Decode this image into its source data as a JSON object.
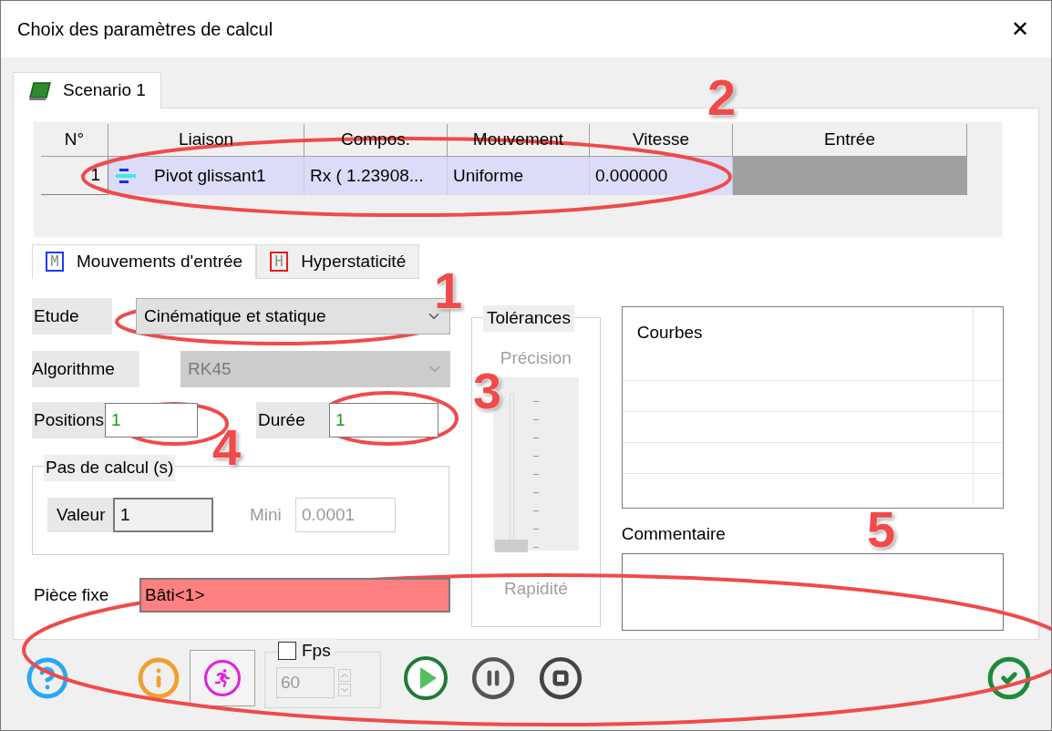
{
  "window": {
    "title": "Choix des paramètres de calcul",
    "close": "✕"
  },
  "tabs": [
    {
      "label": "Scenario 1",
      "selected": true
    }
  ],
  "table": {
    "columns": [
      "N°",
      "Liaison",
      "Compos.",
      "Mouvement",
      "Vitesse",
      "Entrée"
    ],
    "rows": [
      {
        "number": "1",
        "liaison": "Pivot glissant1",
        "compos": "Rx ( 1.23908...",
        "mouvement": "Uniforme",
        "vitesse": "0.000000",
        "selected": true
      }
    ]
  },
  "subtabs": [
    {
      "label": "Mouvements d'entrée",
      "letter": "M",
      "color": "#1a3cf0",
      "selected": true
    },
    {
      "label": "Hyperstaticité",
      "letter": "H",
      "color": "#e02020",
      "selected": false
    }
  ],
  "etude": {
    "label": "Etude",
    "value": "Cinématique et statique",
    "disabled": false
  },
  "algorithme": {
    "label": "Algorithme",
    "value": "RK45",
    "disabled": true
  },
  "positions": {
    "label": "Positions",
    "value": "1"
  },
  "duree": {
    "label": "Durée",
    "value": "1"
  },
  "pas_de_calcul": {
    "title": "Pas de calcul (s)",
    "valeur_label": "Valeur",
    "valeur": "1",
    "mini_label": "Mini",
    "mini": "0.0001",
    "mini_disabled": true
  },
  "piece_fixe": {
    "label": "Pièce fixe",
    "value": "Bâti<1>",
    "invalid": true
  },
  "tolerances": {
    "title": "Tolérances",
    "top_label": "Précision",
    "bottom_label": "Rapidité",
    "level": 0,
    "disabled": true
  },
  "courbes": {
    "header": "Courbes"
  },
  "commentaire": {
    "label": "Commentaire"
  },
  "toolbar": {
    "run_pressed": true,
    "fps_label": "Fps",
    "fps_checked": false,
    "fps_value": "60"
  },
  "annotations": [
    {
      "label": "2"
    },
    {
      "label": "1"
    },
    {
      "label": "3"
    },
    {
      "label": "4"
    },
    {
      "label": "5"
    }
  ]
}
